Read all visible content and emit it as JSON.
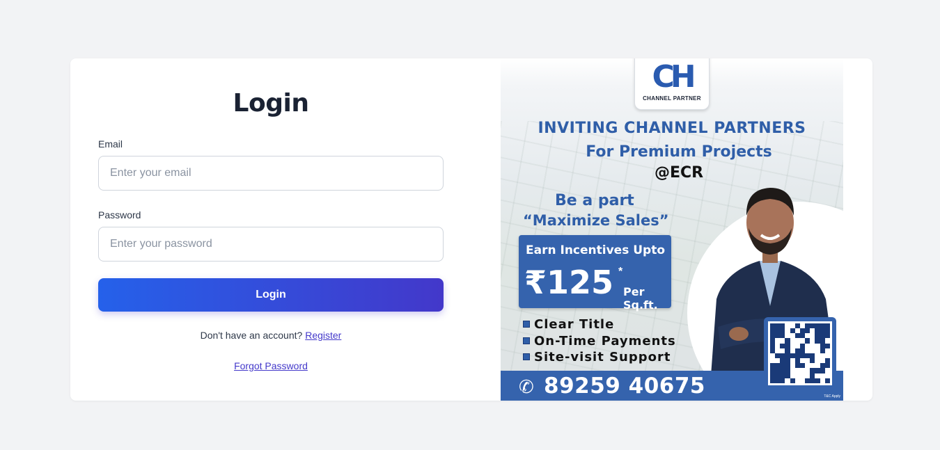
{
  "login": {
    "title": "Login",
    "email_label": "Email",
    "email_placeholder": "Enter your email",
    "password_label": "Password",
    "password_placeholder": "Enter your password",
    "submit_label": "Login",
    "register_prompt": "Don't have an account?",
    "register_link": "Register",
    "forgot_link": "Forgot Password"
  },
  "promo": {
    "logo_mark": "CH",
    "logo_subtitle": "CHANNEL PARTNER",
    "heading": "INVITING CHANNEL PARTNERS",
    "subheading": "For Premium Projects",
    "location": "@ECR",
    "tagline_1": "Be a part",
    "tagline_2": "“Maximize Sales”",
    "incentive_prefix": "Earn Incentives Upto",
    "incentive_amount": "₹125",
    "incentive_star": "*",
    "incentive_unit": "Per Sq.ft.",
    "features": [
      "Clear Title",
      "On-Time Payments",
      "Site-visit Support"
    ],
    "phone": "89259 40675",
    "tc_note": "T&C Apply",
    "colors": {
      "brand_blue": "#3563ad",
      "button_start": "#2561ea",
      "button_end": "#4338ca"
    }
  }
}
